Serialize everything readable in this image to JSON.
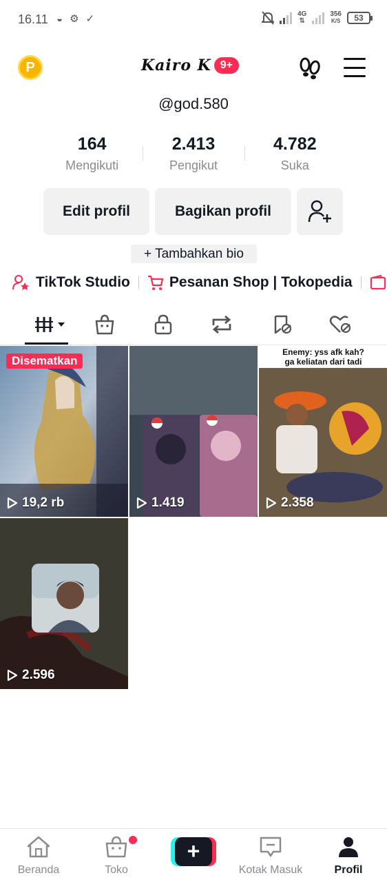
{
  "status_bar": {
    "time": "16.11",
    "network_type": "4G",
    "speed_value": "356",
    "speed_unit": "K/S",
    "battery": "53"
  },
  "header": {
    "coin_letter": "P",
    "profile_name": "Kairo K",
    "notification_badge": "9+",
    "username": "@god.580"
  },
  "stats": [
    {
      "value": "164",
      "label": "Mengikuti"
    },
    {
      "value": "2.413",
      "label": "Pengikut"
    },
    {
      "value": "4.782",
      "label": "Suka"
    }
  ],
  "buttons": {
    "edit_profile": "Edit profil",
    "share_profile": "Bagikan profil",
    "add_bio": "+ Tambahkan bio"
  },
  "links": {
    "studio": "TikTok Studio",
    "shop_orders": "Pesanan Shop | Tokopedia"
  },
  "tabs": {
    "icons": [
      "grid-icon",
      "shop-bag-icon",
      "lock-icon",
      "repost-icon",
      "favorites-icon",
      "liked-icon"
    ],
    "active_index": 0
  },
  "videos": [
    {
      "views": "19,2 rb",
      "pinned_label": "Disematkan"
    },
    {
      "views": "1.419"
    },
    {
      "views": "2.358",
      "caption_line1": "Enemy: yss afk kah?",
      "caption_line2": "ga keliatan dari tadi"
    },
    {
      "views": "2.596"
    }
  ],
  "bottom_nav": {
    "home": "Beranda",
    "shop": "Toko",
    "inbox": "Kotak Masuk",
    "profile": "Profil",
    "create_symbol": "+"
  },
  "colors": {
    "accent": "#fe2c55",
    "cyan": "#25f4ee",
    "text_primary": "#161823",
    "text_secondary": "#8a8b91",
    "button_bg": "#f1f1f2"
  }
}
